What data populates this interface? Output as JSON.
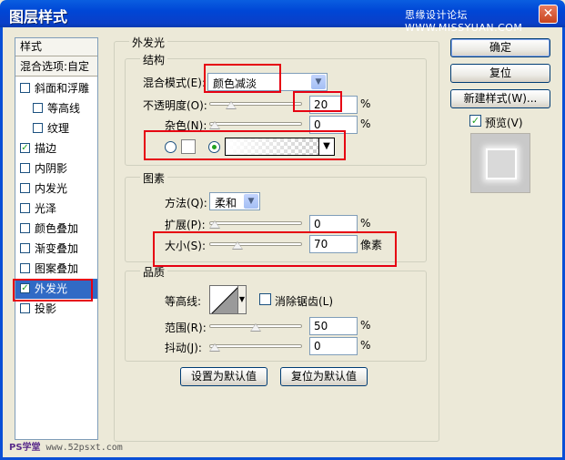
{
  "window": {
    "title": "图层样式",
    "watermark": "思缘设计论坛 WWW.MISSYUAN.COM",
    "close": "✕"
  },
  "styles_panel": {
    "header": "样式",
    "blend_options": "混合选项:自定",
    "items": [
      {
        "label": "斜面和浮雕",
        "checked": false
      },
      {
        "label": "等高线",
        "checked": false
      },
      {
        "label": "纹理",
        "checked": false
      },
      {
        "label": "描边",
        "checked": true
      },
      {
        "label": "内阴影",
        "checked": false
      },
      {
        "label": "内发光",
        "checked": false
      },
      {
        "label": "光泽",
        "checked": false
      },
      {
        "label": "颜色叠加",
        "checked": false
      },
      {
        "label": "渐变叠加",
        "checked": false
      },
      {
        "label": "图案叠加",
        "checked": false
      },
      {
        "label": "外发光",
        "checked": true,
        "selected": true
      },
      {
        "label": "投影",
        "checked": false
      }
    ]
  },
  "outer_glow": {
    "title": "外发光",
    "structure": {
      "legend": "结构",
      "blend_mode_label": "混合模式(E):",
      "blend_mode_value": "颜色减淡",
      "opacity_label": "不透明度(O):",
      "opacity_value": "20",
      "opacity_slider": 20,
      "noise_label": "杂色(N):",
      "noise_value": "0",
      "noise_slider": 0,
      "percent": "%"
    },
    "elements": {
      "legend": "图素",
      "technique_label": "方法(Q):",
      "technique_value": "柔和",
      "spread_label": "扩展(P):",
      "spread_value": "0",
      "spread_slider": 0,
      "size_label": "大小(S):",
      "size_value": "70",
      "size_slider": 28,
      "size_unit": "像素",
      "percent": "%"
    },
    "quality": {
      "legend": "品质",
      "contour_label": "等高线:",
      "anti_alias_label": "消除锯齿(L)",
      "anti_alias_checked": false,
      "range_label": "范围(R):",
      "range_value": "50",
      "range_slider": 50,
      "jitter_label": "抖动(J):",
      "jitter_value": "0",
      "jitter_slider": 0,
      "percent": "%"
    },
    "make_default": "设置为默认值",
    "reset_default": "复位为默认值"
  },
  "buttons": {
    "ok": "确定",
    "reset": "复位",
    "new_style": "新建样式(W)...",
    "preview_label": "预览(V)",
    "preview_checked": true
  },
  "footer": {
    "logo": "PS学堂",
    "site": "www.52psxt.com"
  },
  "colors": {
    "title_bar": "#0046d6",
    "highlight": "#e60012",
    "selection": "#316ac5",
    "check": "#21a121"
  }
}
